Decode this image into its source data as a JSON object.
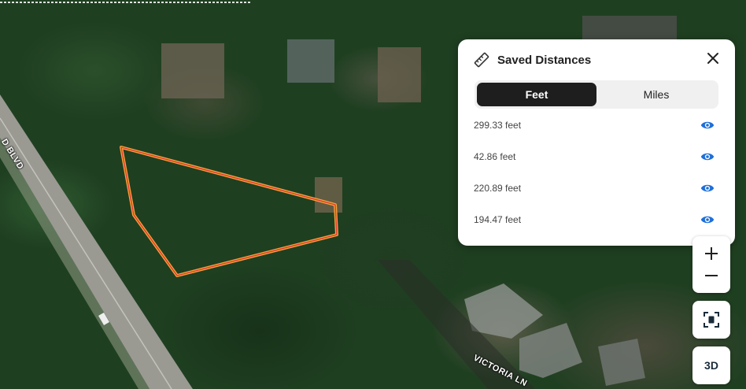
{
  "map": {
    "road_labels": [
      "D BLVD",
      "VICTORIA LN"
    ],
    "boundary_color": "#f2a33c",
    "boundary_inner_color": "#e23a2a"
  },
  "panel": {
    "title": "Saved Distances",
    "icon": "ruler-icon",
    "close_icon": "close-icon",
    "units": {
      "options": [
        "Feet",
        "Miles"
      ],
      "selected": "Feet"
    },
    "distances": [
      {
        "label": "299.33 feet",
        "icon": "eye-icon"
      },
      {
        "label": "42.86 feet",
        "icon": "eye-icon"
      },
      {
        "label": "220.89 feet",
        "icon": "eye-icon"
      },
      {
        "label": "194.47 feet",
        "icon": "eye-icon"
      }
    ]
  },
  "controls": {
    "zoom_in_icon": "plus-icon",
    "zoom_out_icon": "minus-icon",
    "recenter_icon": "focus-frame-icon",
    "view_3d_label": "3D"
  },
  "colors": {
    "accent_blue": "#1e6fd9",
    "toggle_active": "#1e1e1e"
  }
}
